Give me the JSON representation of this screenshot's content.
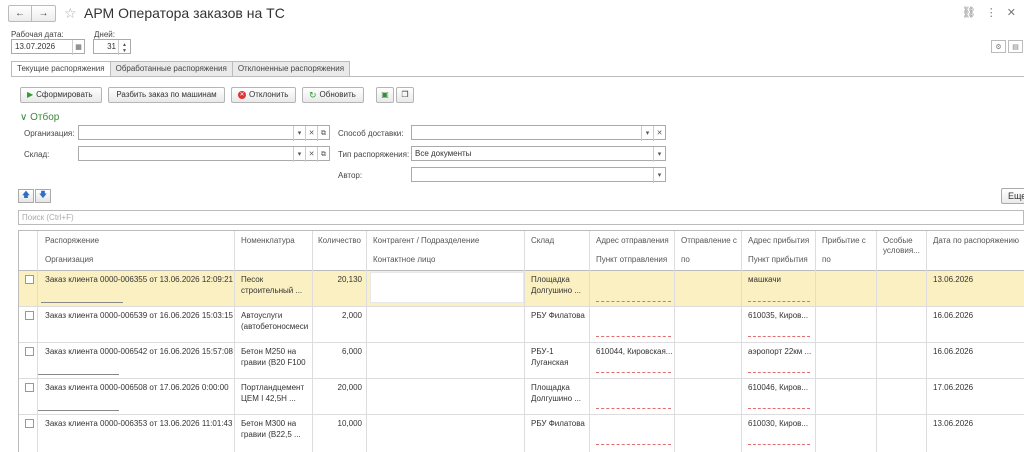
{
  "window": {
    "title": "АРМ Оператора заказов на ТС",
    "back_icon": "←",
    "forward_icon": "→",
    "star_icon": "☆"
  },
  "header": {
    "date_label": "Рабочая дата:",
    "date_value": "13.07.2026",
    "days_label": "Дней:",
    "days_value": "31"
  },
  "tabs": [
    "Текущие распоряжения",
    "Обработанные распоряжения",
    "Отклоненные распоряжения"
  ],
  "toolbar": {
    "form_label": "Сформировать",
    "split_label": "Разбить заказ по машинам",
    "reject_label": "Отклонить",
    "refresh_label": "Обновить"
  },
  "filter": {
    "title": "Отбор",
    "org_label": "Организация:",
    "org_value": "",
    "warehouse_label": "Склад:",
    "warehouse_value": "",
    "delivery_label": "Способ доставки:",
    "delivery_value": "",
    "type_label": "Тип распоряжения:",
    "type_value": "Все документы",
    "author_label": "Автор:",
    "author_value": ""
  },
  "list": {
    "more_label": "Еще",
    "search_placeholder": "Поиск (Ctrl+F)"
  },
  "columns": {
    "order": "Распоряжение",
    "org": "Организация",
    "nomen": "Номенклатура",
    "qty": "Количество",
    "contractor": "Контрагент / Подразделение",
    "contact": "Контактное лицо",
    "warehouse": "Склад",
    "from_addr": "Адрес отправления",
    "from_point": "Пункт отправления",
    "dep_from": "Отправление с",
    "dep_to": "по",
    "to_addr": "Адрес прибытия",
    "to_point": "Пункт прибытия",
    "arr_from": "Прибытие с",
    "arr_to": "по",
    "special": "Особые условия...",
    "date": "Дата по распоряжению"
  },
  "rows": [
    {
      "order": "Заказ клиента 0000-006355 от 13.06.2026 12:09:21",
      "nomen1": "Песок",
      "nomen2": "строительный ...",
      "qty": "20,130",
      "wh1": "Площадка",
      "wh2": "Долгушино ...",
      "from": "",
      "to": "машкачи",
      "date": "13.06.2026"
    },
    {
      "order": "Заказ клиента 0000-006539 от 16.06.2026 15:03:15",
      "nomen1": "Автоуслуги",
      "nomen2": "(автобетоносмеси",
      "qty": "2,000",
      "wh1": "РБУ Филатова",
      "wh2": "",
      "from": "",
      "to": "610035, Киров...",
      "date": "16.06.2026"
    },
    {
      "order": "Заказ клиента 0000-006542 от 16.06.2026 15:57:08",
      "nomen1": "Бетон М250 на",
      "nomen2": "гравии (B20 F100",
      "qty": "6,000",
      "wh1": "РБУ-1",
      "wh2": "Луганская",
      "from": "610044, Кировская...",
      "to": "аэропорт 22км ...",
      "date": "16.06.2026"
    },
    {
      "order": "Заказ клиента 0000-006508 от 17.06.2026 0:00:00",
      "nomen1": "Портландцемент",
      "nomen2": "ЦЕМ I 42,5Н ...",
      "qty": "20,000",
      "wh1": "Площадка",
      "wh2": "Долгушино ...",
      "from": "",
      "to": "610046, Киров...",
      "date": "17.06.2026"
    },
    {
      "order": "Заказ клиента 0000-006353 от 13.06.2026 11:01:43",
      "nomen1": "Бетон М300 на",
      "nomen2": "гравии (B22,5 ...",
      "qty": "10,000",
      "wh1": "РБУ Филатова",
      "wh2": "",
      "from": "",
      "to": "610030, Киров...",
      "date": "13.06.2026"
    }
  ]
}
